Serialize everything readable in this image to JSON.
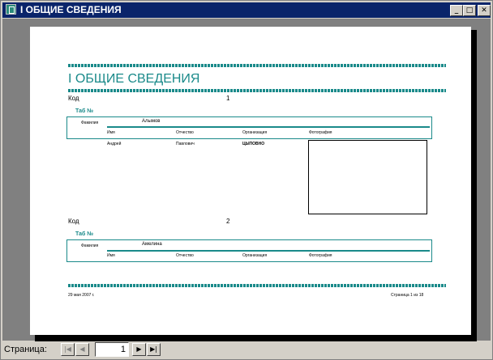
{
  "window": {
    "title": "I ОБЩИЕ СВЕДЕНИЯ",
    "controls": {
      "minimize": "_",
      "maximize": "□",
      "close": "✕"
    }
  },
  "report": {
    "title": "I ОБЩИЕ СВЕДЕНИЯ",
    "records": [
      {
        "code_label": "Код",
        "code_value": "1",
        "tab_label": "Таб №",
        "surname_label": "Фамилия",
        "surname": "Алымов",
        "headers": [
          "Имя",
          "Отчество",
          "Организация",
          "Фотография"
        ],
        "name": "Андрей",
        "patronymic": "Павлович",
        "organization": "ЦЫПОВНО"
      },
      {
        "code_label": "Код",
        "code_value": "2",
        "tab_label": "Таб №",
        "surname_label": "Фамилия",
        "surname": "Амелина",
        "headers": [
          "Имя",
          "Отчество",
          "Организация",
          "Фотография"
        ]
      }
    ],
    "footer": {
      "date": "29 мая 2007 г.",
      "page_info": "Страница 1 из 18"
    }
  },
  "statusbar": {
    "page_label": "Страница:",
    "current_page": "1",
    "first_icon": "first-page-icon",
    "prev_icon": "prev-page-icon",
    "next_icon": "next-page-icon",
    "last_icon": "last-page-icon"
  }
}
